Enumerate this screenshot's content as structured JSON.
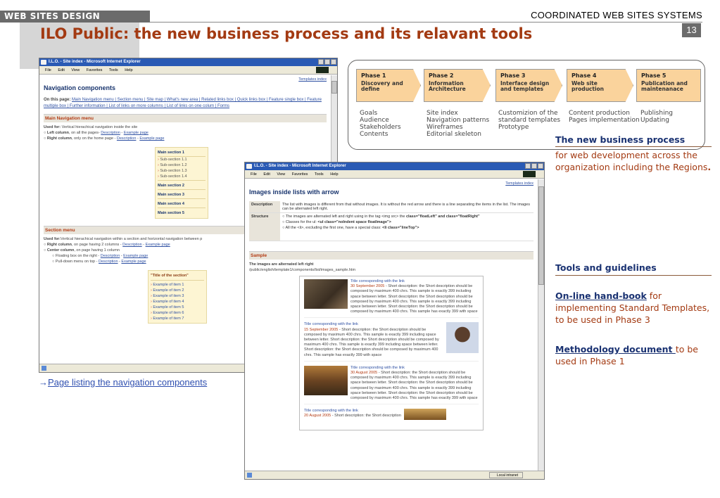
{
  "header": {
    "left_label": "WEB SITES DESIGN",
    "right_label": "COORDINATED WEB SITES SYSTEMS",
    "page_number": "13",
    "title": "ILO Public: the new business process and its relavant tools"
  },
  "window1": {
    "title": "I.L.O. - Site index - Microsoft Internet Explorer",
    "menu": [
      "File",
      "Edit",
      "View",
      "Favorites",
      "Tools",
      "Help"
    ],
    "templates_index": "Templates index",
    "heading": "Navigation components",
    "on_this_page_label": "On this page:",
    "on_this_page_links": "Main Navigation menu | Section menu | Site map | What's new area | Related links box | Quick links box | Feature single box | Feature multiple box | Further information | List of links on more columns | List of links on one colum | Forms",
    "main_nav": {
      "title": "Main Navigation menu",
      "used_for_label": "Used for:",
      "used_for_text": "Vertical hierachical navigation inside the site",
      "left_label": "Left column",
      "left_text": ", on all the pages-",
      "right_label": "Right column",
      "right_text": ", only on the home page -",
      "desc_link": "Description",
      "sep": " - ",
      "example_link": "Example page"
    },
    "yellow_menu": {
      "main1": "Main section 1",
      "subs": [
        "Sub-section 1.1",
        "Sub-section 1.2",
        "Sub-section 1.3",
        "Sub-section 1.4"
      ],
      "main2": "Main section 2",
      "main3": "Main section 3",
      "main4": "Main section 4",
      "main5": "Main section 5"
    },
    "section_menu": {
      "title": "Section menu",
      "used_for_label": "Used for:",
      "used_for_text": "Vertical hierachical navigation within a section and horizontal navigation between p",
      "right_label": "Right column",
      "right_text": ", on page having 2 columns -",
      "center_label": "Center column",
      "center_text": ", on page having 1 column",
      "floating_text": "Floating box on the right -",
      "pulldown_text": "Pull-down menu on top -",
      "desc_link": "Description",
      "sep": " - ",
      "example_link": "Example page"
    },
    "section_box": {
      "title": "\"Title of the section\"",
      "items": [
        "Example of item 1",
        "Example of item 2",
        "Example of item 3",
        "Example of item 4",
        "Example of item 5",
        "Example of item 6",
        "Example of item 7"
      ]
    }
  },
  "page_link": {
    "arrow": "→",
    "text": "Page listing the navigation components"
  },
  "window2": {
    "title": "I.L.O. - Site index - Microsoft Internet Explorer",
    "menu": [
      "File",
      "Edit",
      "View",
      "Favorites",
      "Tools",
      "Help"
    ],
    "templates_index": "Templates index",
    "heading": "Images inside lists with arrow",
    "description_label": "Description",
    "description_text": "The list with images is different from that without images. It is without the red arrow and there is a line separating the items in the list. The images can be alternated left right.",
    "structure_label": "Structure",
    "structure_1_pre": "The images are alternated left and right using in the tag <img src> the",
    "structure_1_bold": "class=\"floatLeft\" and class=\"floatRight\"",
    "structure_2_pre": "Classes for the ul:",
    "structure_2_bold": "<ul class=\"noIndent space floatImage\">",
    "structure_3_pre": "All the <li>, excluding the first one, have a special class:",
    "structure_3_bold": "<li class=\"lineTop\">",
    "sample_label": "Sample",
    "sample_sub": "The images are alternated left right",
    "sample_path": "/public/english/template1/components/list/images_sample.htm",
    "items": [
      {
        "title": "Title corresponding with the link",
        "date": "30 September 2005",
        "text": " - Short description: the Short description should be composed by maximum 400 chrs. This sample is exactly 399 including space between letter. Short description: the Short description should be composed by maximum 400 chrs. This sample is exactly 399 including space between letter. Short description: the Short description should be composed by maximum 400 chrs. This sample has exactly 399 with space"
      },
      {
        "title": "Title corresponding with the link",
        "date": "15 September 2005",
        "text": " - Short description: the Short description should be composed by maximum 400 chrs. This sample is exactly 399 including space between letter. Short description: the Short description should be composed by maximum 400 chrs. This sample is exactly 399 including space between letter. Short description: the Short description should be composed by maximum 400 chrs. This sample has exactly 399 with space"
      },
      {
        "title": "Title corresponding with the link",
        "date": "30 August 2005",
        "text": " - Short description: the Short description should be composed by maximum 400 chrs. This sample is exactly 399 including space between letter. Short description: the Short description should be composed by maximum 400 chrs. This sample is exactly 399 including space between letter. Short description: the Short description should be composed by maximum 400 chrs. This sample has exactly 399 with space"
      },
      {
        "title": "Title corresponding with the link",
        "date": "20 August 2005",
        "text": " - Short description: the Short description"
      }
    ],
    "status_zone": "Local intranet"
  },
  "phases": [
    {
      "name": "Phase 1",
      "desc": "Discovery and define",
      "list": [
        "Goals",
        "Audience",
        "Stakeholders",
        "Contents"
      ]
    },
    {
      "name": "Phase 2",
      "desc": "Information Architecture",
      "list": [
        "Site index",
        "Navigation patterns",
        "Wireframes",
        "Editorial skeleton"
      ]
    },
    {
      "name": "Phase 3",
      "desc": "Interface design and templates",
      "list": [
        "Customizion of the",
        "standard templates",
        "Prototype"
      ]
    },
    {
      "name": "Phase 4",
      "desc": "Web site production",
      "list": [
        "Content production",
        "Pages implementation"
      ]
    },
    {
      "name": "Phase 5",
      "desc": "Publication and maintenanace",
      "list": [
        "Publishing",
        "Updating"
      ]
    }
  ],
  "business_process": {
    "title": "The new  business process",
    "text": "for web development across the organization including the Regions",
    "suffix": "."
  },
  "tools": {
    "title": "Tools and guidelines",
    "p1_link": "On-line hand-book",
    "p1_text": " for implementing Standard Templates, to be used in Phase 3",
    "p2_link": "Methodology document ",
    "p2_text": "to be used in Phase 1"
  }
}
